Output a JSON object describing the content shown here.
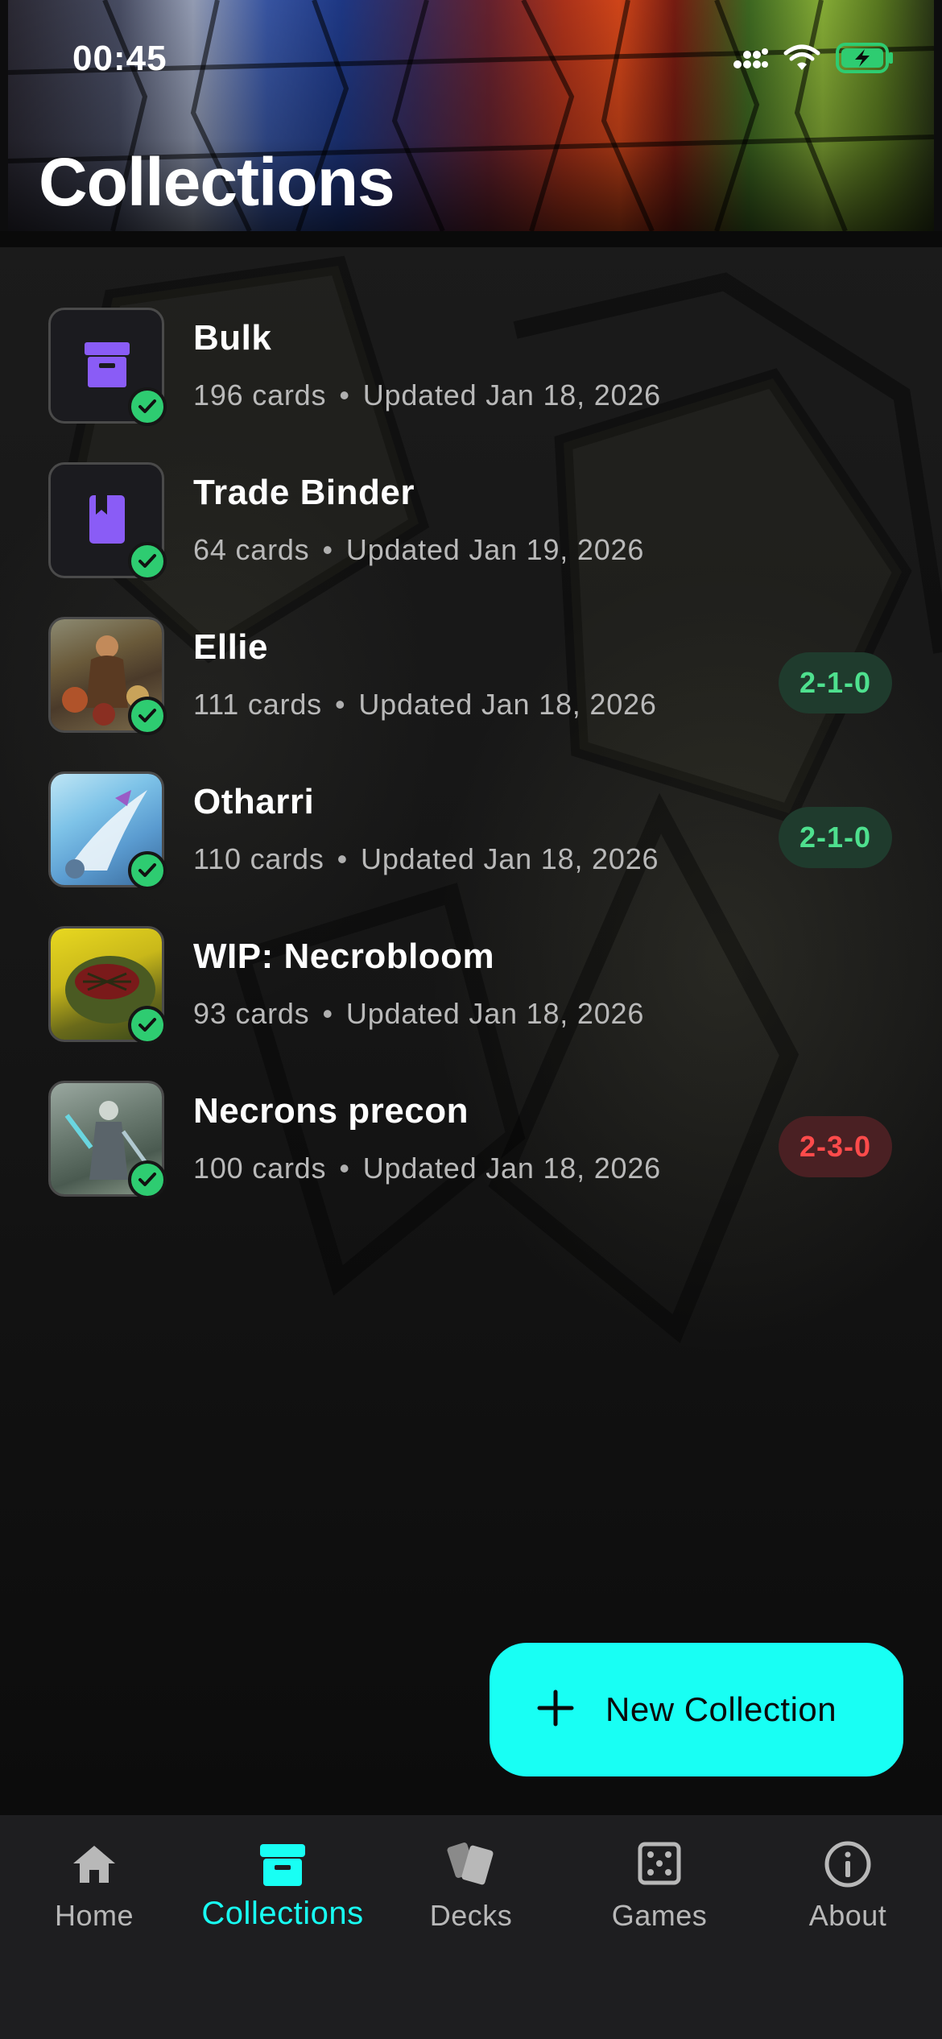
{
  "status_bar": {
    "time": "00:45"
  },
  "header": {
    "title": "Collections"
  },
  "collections": [
    {
      "name": "Bulk",
      "count": "196 cards",
      "updated": "Updated Jan 18, 2026",
      "icon": "archive-icon",
      "record": ""
    },
    {
      "name": "Trade Binder",
      "count": "64 cards",
      "updated": "Updated Jan 19, 2026",
      "icon": "bookmark-icon",
      "record": ""
    },
    {
      "name": "Ellie",
      "count": "111 cards",
      "updated": "Updated Jan 18, 2026",
      "icon": "card-art",
      "record": "2-1-0"
    },
    {
      "name": "Otharri",
      "count": "110 cards",
      "updated": "Updated Jan 18, 2026",
      "icon": "card-art",
      "record": "2-1-0"
    },
    {
      "name": "WIP: Necrobloom",
      "count": "93 cards",
      "updated": "Updated Jan 18, 2026",
      "icon": "card-art",
      "record": ""
    },
    {
      "name": "Necrons precon",
      "count": "100 cards",
      "updated": "Updated Jan 18, 2026",
      "icon": "card-art",
      "record": "2-3-0"
    }
  ],
  "fab": {
    "label": "New Collection",
    "icon": "plus-icon"
  },
  "nav": {
    "items": [
      {
        "label": "Home",
        "icon": "home-icon"
      },
      {
        "label": "Collections",
        "icon": "archive-icon"
      },
      {
        "label": "Decks",
        "icon": "cards-icon"
      },
      {
        "label": "Games",
        "icon": "dice-icon"
      },
      {
        "label": "About",
        "icon": "info-icon"
      }
    ]
  },
  "colors": {
    "accent": "#18fff4",
    "purple": "#8a5cf6",
    "win": "#4ee08e",
    "loss": "#ff4b4b",
    "check": "#2ecc71"
  }
}
